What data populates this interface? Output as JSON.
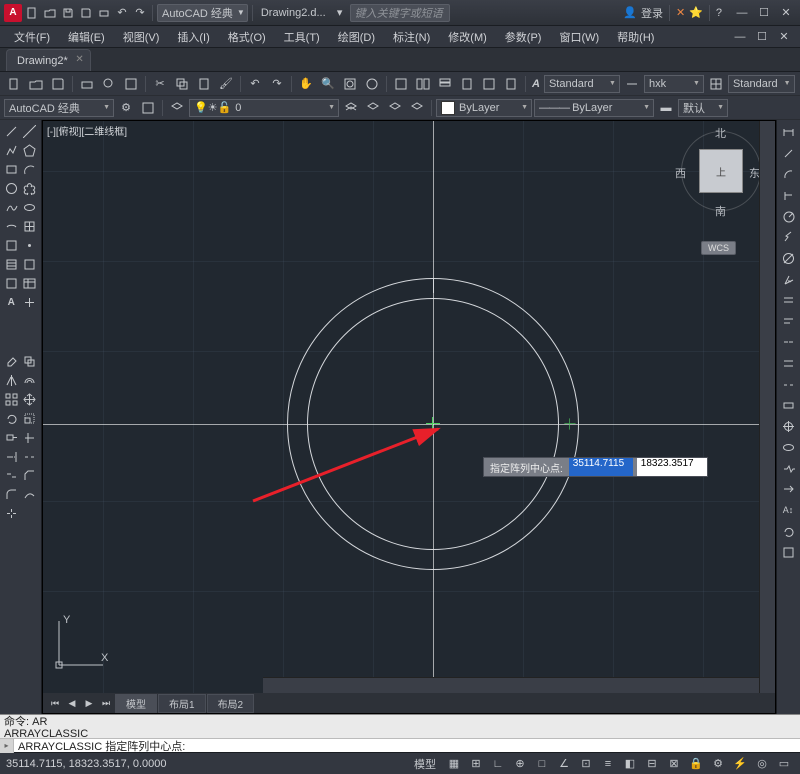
{
  "title": {
    "workspace": "AutoCAD 经典",
    "doc": "Drawing2.d...",
    "search_placeholder": "键入关键字或短语",
    "login": "登录"
  },
  "menu": [
    "文件(F)",
    "编辑(E)",
    "视图(V)",
    "插入(I)",
    "格式(O)",
    "工具(T)",
    "绘图(D)",
    "标注(N)",
    "修改(M)",
    "参数(P)",
    "窗口(W)",
    "帮助(H)"
  ],
  "doctab": {
    "name": "Drawing2*"
  },
  "props": {
    "workspace_combo": "AutoCAD 经典",
    "text_style": "Standard",
    "dim_style": "hxk",
    "table_style": "Standard",
    "layer_combo": "ByLayer",
    "color_combo": "ByLayer",
    "default_btn": "默认"
  },
  "viewport": {
    "label": "[-][俯视][二维线框]"
  },
  "viewcube": {
    "face": "上",
    "n": "北",
    "s": "南",
    "e": "东",
    "w": "西",
    "wcs": "WCS"
  },
  "prompt": {
    "label": "指定阵列中心点:",
    "x": "35114.7115",
    "y": "18323.3517"
  },
  "ucs": {
    "y": "Y",
    "x": "X"
  },
  "layout_tabs": {
    "model": "模型",
    "l1": "布局1",
    "l2": "布局2"
  },
  "cmd": {
    "line1": "命令: AR",
    "line2": "ARRAYCLASSIC",
    "line3": "ARRAYCLASSIC 指定阵列中心点:"
  },
  "status": {
    "coords": "35114.7115, 18323.3517, 0.0000",
    "model": "模型"
  }
}
